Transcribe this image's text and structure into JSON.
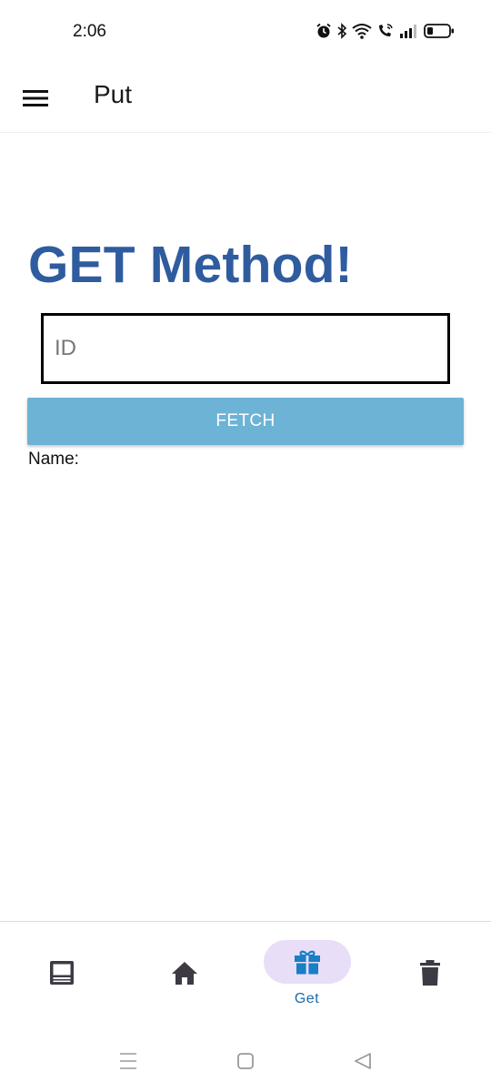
{
  "status_bar": {
    "time": "2:06",
    "icons": [
      "alarm-icon",
      "bluetooth-icon",
      "wifi-icon",
      "wifi-calling-icon",
      "signal-icon",
      "battery-icon"
    ]
  },
  "app_bar": {
    "title": "Put",
    "menu_icon": "hamburger-menu-icon"
  },
  "main": {
    "heading": "GET Method!",
    "id_input": {
      "placeholder": "ID",
      "value": ""
    },
    "fetch_button": "FETCH",
    "name_label": "Name:",
    "name_value": ""
  },
  "bottom_nav": {
    "items": [
      {
        "icon": "laptop-icon",
        "label": "",
        "active": false
      },
      {
        "icon": "home-icon",
        "label": "",
        "active": false
      },
      {
        "icon": "gift-icon",
        "label": "Get",
        "active": true
      },
      {
        "icon": "trash-icon",
        "label": "",
        "active": false
      }
    ]
  },
  "system_nav": {
    "buttons": [
      "recents-icon",
      "home-square-icon",
      "back-icon"
    ]
  },
  "colors": {
    "heading": "#2f5c9e",
    "button": "#6db3d6",
    "active_pill": "#e9def8",
    "active_icon": "#1a7fc4",
    "inactive_icon": "#3d3a44"
  }
}
